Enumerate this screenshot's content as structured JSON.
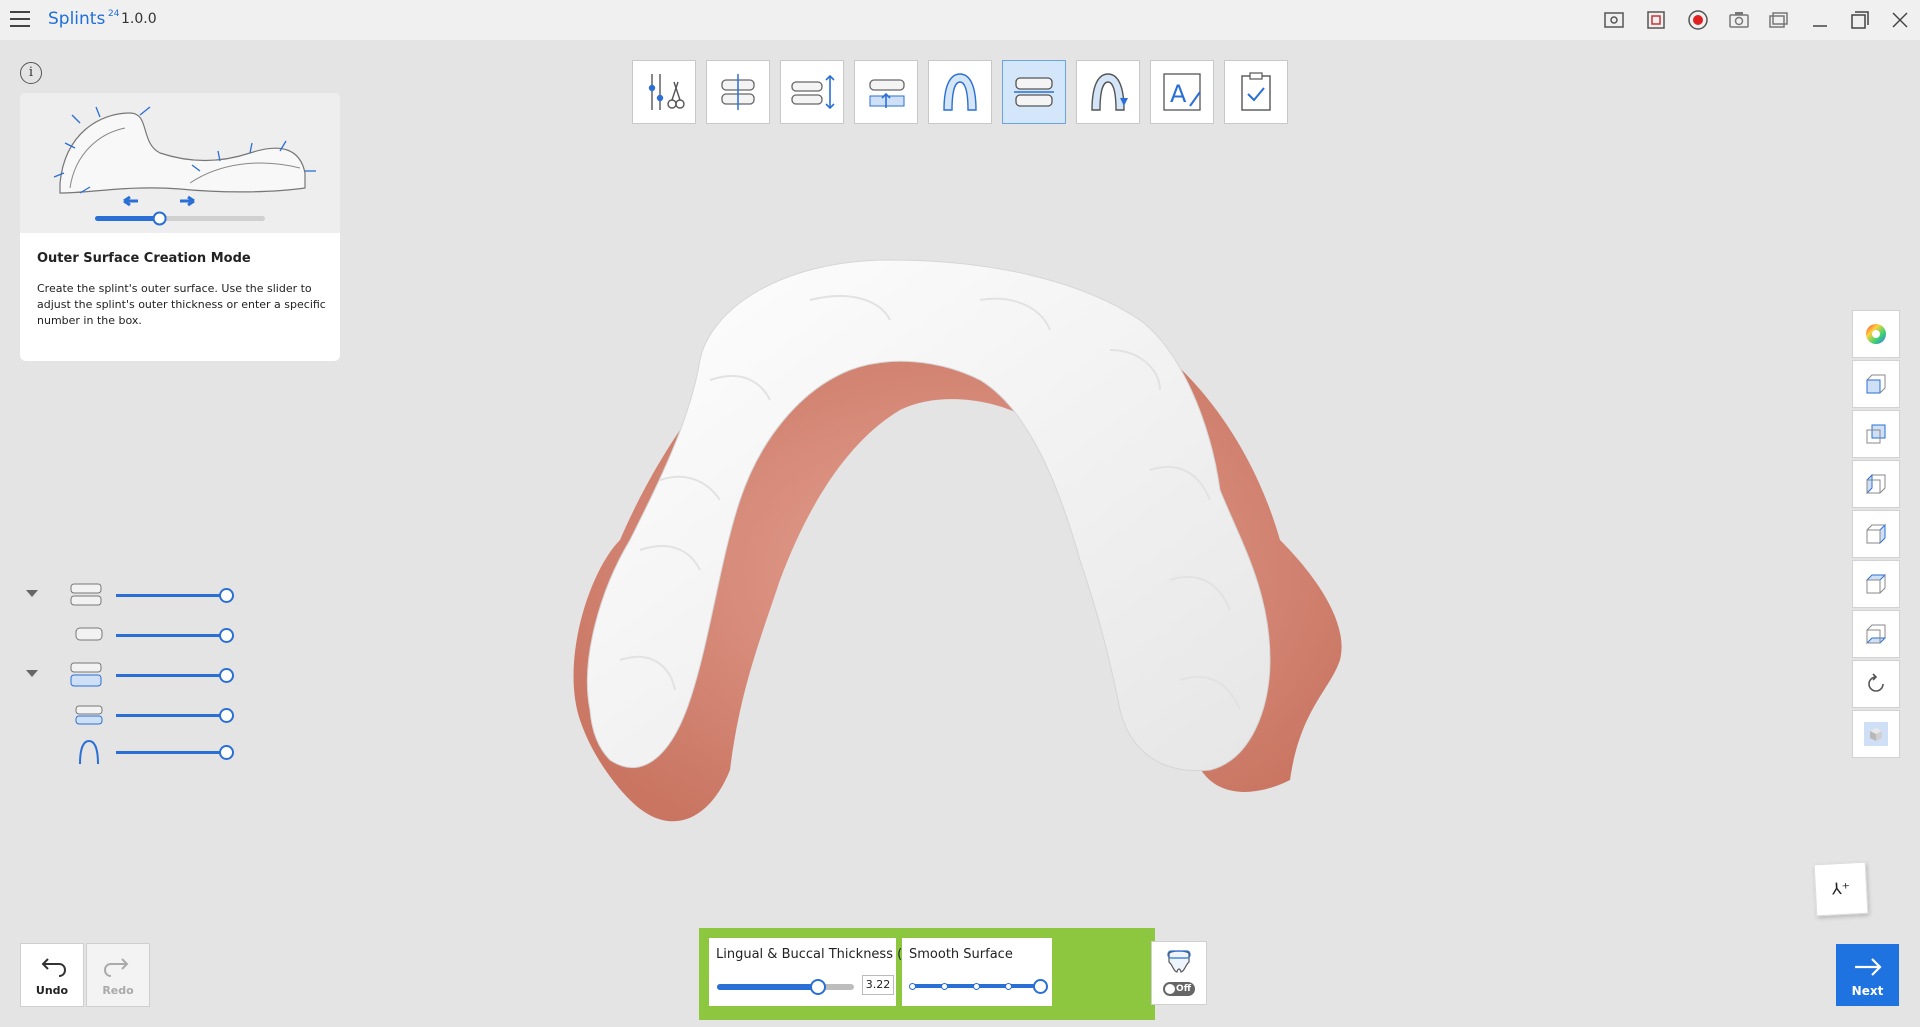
{
  "app": {
    "name": "Splints",
    "sup": "24",
    "version": "1.0.0"
  },
  "titlebar_icons": [
    "capture-settings-icon",
    "screen-record-icon",
    "record-icon",
    "camera-icon",
    "windows-icon",
    "minimize-icon",
    "maximize-icon",
    "close-icon"
  ],
  "info_panel": {
    "title": "Outer Surface Creation Mode",
    "description": "Create the splint's outer surface. Use the slider to adjust the splint's outer thickness or enter a specific number in the box.",
    "illustration_slider_level": 0.38
  },
  "workflow_steps": [
    {
      "name": "tools-step",
      "icon": "instruments-icon",
      "active": false
    },
    {
      "name": "align-step",
      "icon": "align-teeth-icon",
      "active": false
    },
    {
      "name": "bite-step",
      "icon": "bite-icon",
      "active": false
    },
    {
      "name": "insertion-step",
      "icon": "insertion-icon",
      "active": false
    },
    {
      "name": "margin-step",
      "icon": "arch-icon",
      "active": false
    },
    {
      "name": "outer-surface-step",
      "icon": "outer-surface-icon",
      "active": true
    },
    {
      "name": "design-step",
      "icon": "splint-design-icon",
      "active": false
    },
    {
      "name": "text-step",
      "icon": "text-edit-icon",
      "active": false
    },
    {
      "name": "finish-step",
      "icon": "clipboard-check-icon",
      "active": false
    }
  ],
  "view_tools": [
    "color-wheel-icon",
    "view-front-icon",
    "view-back-icon",
    "view-left-icon",
    "view-right-icon",
    "view-top-icon",
    "view-bottom-icon",
    "rotate-icon",
    "shaded-cube-icon"
  ],
  "layers": [
    {
      "caret": true,
      "icon": "maxillary-group-icon",
      "opacity": 1.0
    },
    {
      "caret": false,
      "icon": "maxilla-icon",
      "opacity": 1.0
    },
    {
      "caret": true,
      "icon": "mandibular-group-icon",
      "opacity": 1.0
    },
    {
      "caret": false,
      "icon": "mandible-icon",
      "opacity": 1.0
    },
    {
      "caret": false,
      "icon": "splint-arch-icon",
      "opacity": 1.0
    }
  ],
  "controls": {
    "undo_label": "Undo",
    "redo_label": "Redo",
    "next_label": "Next",
    "thickness_label": "Lingual & Buccal Thickness (mm)",
    "thickness_value": "3.22",
    "thickness_level": 0.74,
    "smooth_label": "Smooth Surface",
    "smooth_level": 1.0,
    "smooth_steps": 5,
    "toggle_label": "Off"
  },
  "colors": {
    "accent": "#1e73e0",
    "highlight": "#8dc63f",
    "gum": "#d98a76",
    "splint": "#ffffff",
    "viewport_bg": "#e4e4e4"
  }
}
